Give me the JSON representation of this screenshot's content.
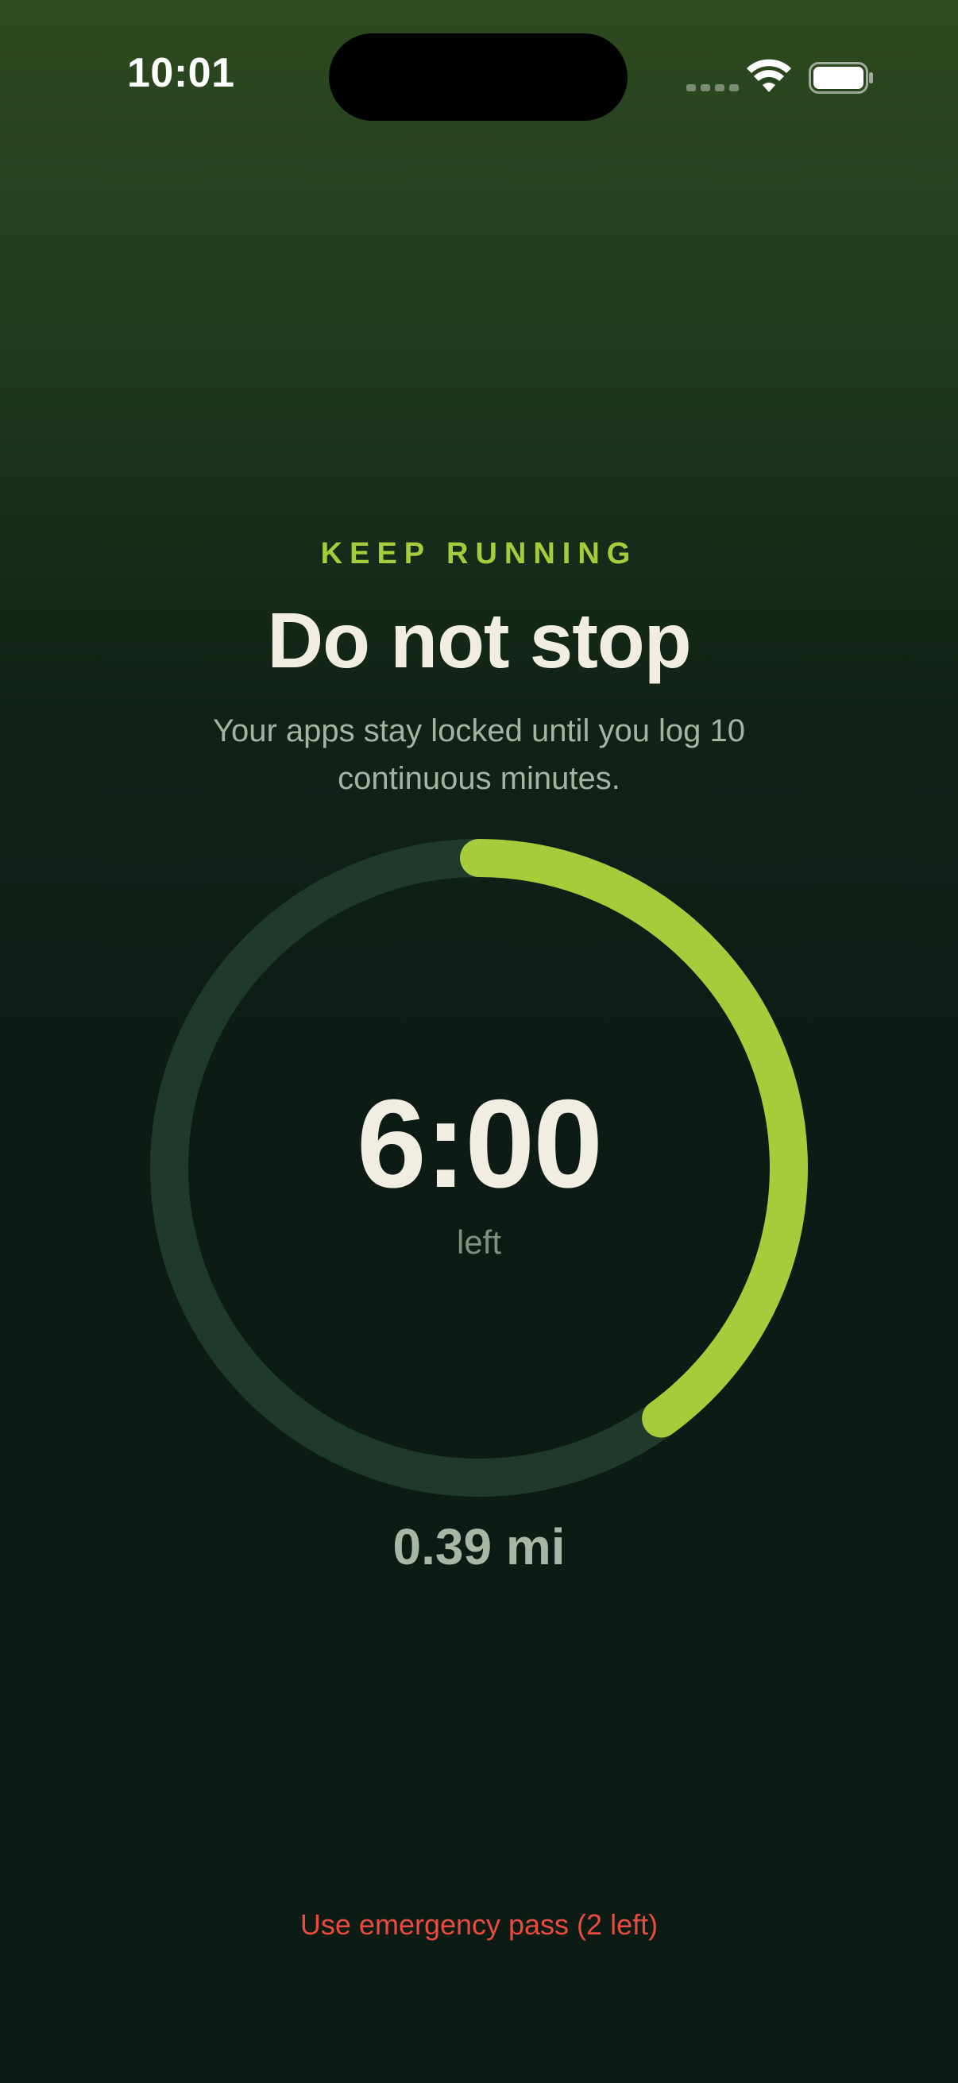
{
  "status_bar": {
    "time": "10:01",
    "icons": [
      "cellular-signal-icon",
      "wifi-icon",
      "battery-icon"
    ]
  },
  "header": {
    "eyebrow": "KEEP RUNNING",
    "title": "Do not stop",
    "subtitle": "Your apps stay locked until you log 10 continuous minutes."
  },
  "timer": {
    "value": "6:00",
    "caption": "left",
    "progress": 0.4
  },
  "distance": "0.39 mi",
  "emergency": {
    "label": "Use emergency pass (2 left)"
  },
  "colors": {
    "accent": "#a6cc3c",
    "ring_track": "#1f3a2a",
    "danger": "#ea4b3e",
    "text_primary": "#f1ede2"
  }
}
